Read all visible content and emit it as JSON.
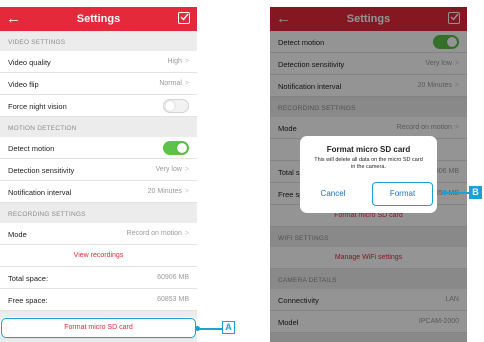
{
  "left_screen": {
    "header": {
      "title": "Settings",
      "back_icon": "arrow-left-icon",
      "confirm_icon": "checkbox-icon"
    },
    "sections": [
      {
        "title": "VIDEO SETTINGS",
        "rows": [
          {
            "label": "Video quality",
            "value": "High"
          },
          {
            "label": "Video flip",
            "value": "Normal"
          },
          {
            "label": "Force night vision",
            "toggle": false
          }
        ]
      },
      {
        "title": "MOTION DETECTION",
        "rows": [
          {
            "label": "Detect motion",
            "toggle": true
          },
          {
            "label": "Detection sensitivity",
            "value": "Very low"
          },
          {
            "label": "Notification interval",
            "value": "20 Minutes"
          }
        ]
      },
      {
        "title": "RECORDING SETTINGS",
        "rows": [
          {
            "label": "Mode",
            "value": "Record on motion"
          },
          {
            "label": "View recordings"
          },
          {
            "label": "Total space:",
            "value": "60906 MB"
          },
          {
            "label": "Free space:",
            "value": "60853 MB"
          },
          {
            "label": "Format micro SD card"
          }
        ]
      }
    ]
  },
  "right_screen": {
    "header": {
      "title": "Settings",
      "back_icon": "arrow-left-icon",
      "confirm_icon": "checkbox-icon"
    },
    "top_rows": [
      {
        "label": "Detect motion",
        "toggle": true
      },
      {
        "label": "Detection sensitivity",
        "value": "Very low"
      },
      {
        "label": "Notification interval",
        "value": "20 Minutes"
      }
    ],
    "recording_title": "RECORDING SETTINGS",
    "recording_rows": [
      {
        "label": "Mode",
        "value": "Record on motion"
      },
      {
        "label": "Total space:",
        "value": "60906 MB"
      },
      {
        "label": "Free space:",
        "value": "60853 MB"
      },
      {
        "label": "Format micro SD card"
      }
    ],
    "wifi_title": "WIFI SETTINGS",
    "wifi_link": "Manage WiFi settings",
    "camera_title": "CAMERA DETAILS",
    "camera_rows": [
      {
        "label": "Connectivity",
        "value": "LAN"
      },
      {
        "label": "Model",
        "value": "IPCAM-2000"
      }
    ],
    "dialog": {
      "title": "Format micro SD card",
      "message": "This will delete all data on the micro SD card in the camera.",
      "cancel_label": "Cancel",
      "format_label": "Format"
    }
  },
  "callouts": {
    "a": "A",
    "b": "B"
  },
  "colors": {
    "accent": "#e4293a",
    "toggle_on": "#5cc248",
    "callout": "#1d9fd8",
    "link": "#1e73be"
  }
}
